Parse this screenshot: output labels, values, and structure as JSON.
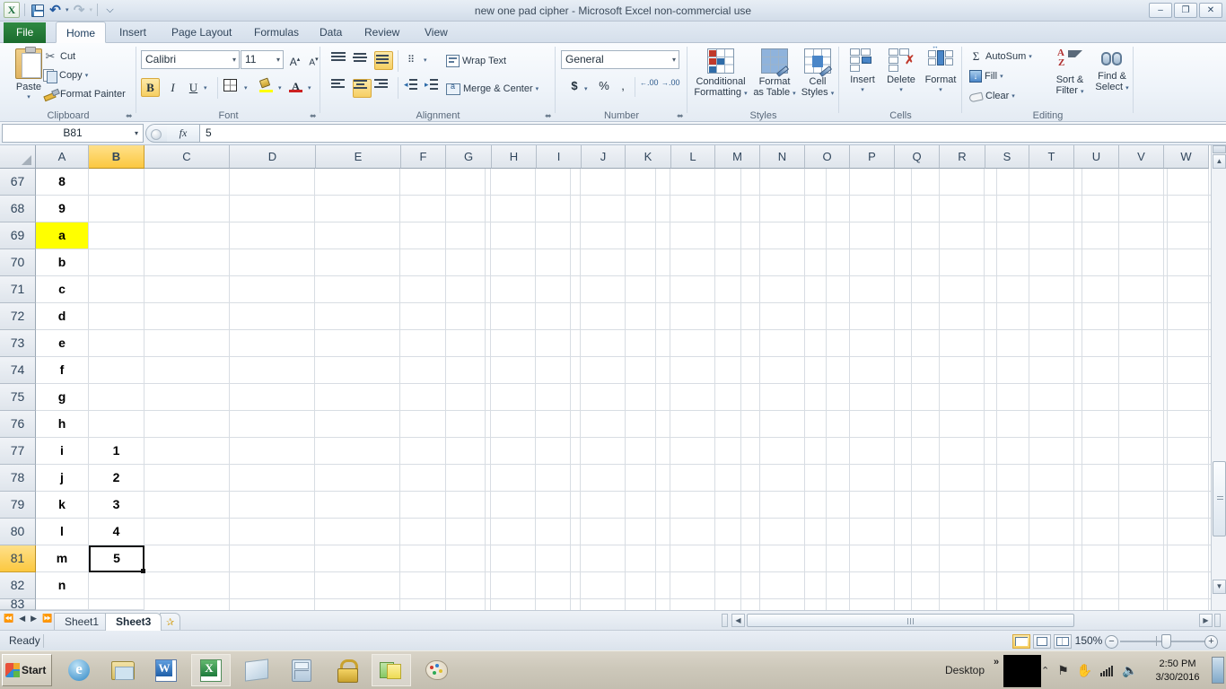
{
  "window": {
    "title": "new one pad cipher  -  Microsoft Excel non-commercial use",
    "minimize_label": "–",
    "restore_label": "❐",
    "close_label": "✕"
  },
  "quick_access": {
    "app_logo": "excel-logo",
    "save_label": "save-icon",
    "undo_label": "↶",
    "undo_caret": "▾",
    "redo_label": "↷",
    "redo_caret": "▾",
    "customize_label": "⌵"
  },
  "ribbon": {
    "tabs": [
      {
        "label": "File",
        "active": false,
        "is_file": true
      },
      {
        "label": "Home",
        "active": true
      },
      {
        "label": "Insert",
        "active": false
      },
      {
        "label": "Page Layout",
        "active": false
      },
      {
        "label": "Formulas",
        "active": false
      },
      {
        "label": "Data",
        "active": false
      },
      {
        "label": "Review",
        "active": false
      },
      {
        "label": "View",
        "active": false
      }
    ],
    "collapse_label": "⌃",
    "help_label": "?",
    "groups": {
      "clipboard": {
        "name": "Clipboard",
        "paste_label": "Paste",
        "paste_caret": "▾",
        "cut_label": "Cut",
        "copy_label": "Copy",
        "copy_caret": "▾",
        "format_painter_label": "Format Painter",
        "dialog_launcher": "⬌"
      },
      "font": {
        "name": "Font",
        "font_family_value": "Calibri",
        "font_size_value": "11",
        "grow_font_label": "A",
        "shrink_font_label": "A",
        "bold_label": "B",
        "italic_label": "I",
        "underline_label": "U",
        "underline_caret": "▾",
        "borders_caret": "▾",
        "fill_color_caret": "▾",
        "font_color_caret": "▾",
        "dialog_launcher": "⬌",
        "combo_caret": "▾"
      },
      "alignment": {
        "name": "Alignment",
        "orientation_caret": "▾",
        "wrap_text_label": "Wrap Text",
        "merge_center_label": "Merge & Center",
        "merge_caret": "▾",
        "dialog_launcher": "⬌"
      },
      "number": {
        "name": "Number",
        "format_value": "General",
        "format_caret": "▾",
        "currency_label": "$",
        "currency_caret": "▾",
        "percent_label": "%",
        "comma_label": ",",
        "increase_decimal_label": ".00",
        "decrease_decimal_label": ".00",
        "dialog_launcher": "⬌"
      },
      "styles": {
        "name": "Styles",
        "conditional_formatting_line1": "Conditional",
        "conditional_formatting_line2": "Formatting",
        "format_as_table_line1": "Format",
        "format_as_table_line2": "as Table",
        "cell_styles_line1": "Cell",
        "cell_styles_line2": "Styles",
        "caret": "▾"
      },
      "cells": {
        "name": "Cells",
        "insert_label": "Insert",
        "delete_label": "Delete",
        "format_label": "Format",
        "caret": "▾"
      },
      "editing": {
        "name": "Editing",
        "autosum_label": "AutoSum",
        "autosum_caret": "▾",
        "fill_label": "Fill",
        "fill_caret": "▾",
        "clear_label": "Clear",
        "clear_caret": "▾",
        "sort_filter_line1": "Sort &",
        "sort_filter_line2": "Filter",
        "find_select_line1": "Find &",
        "find_select_line2": "Select",
        "sigma_label": "Σ",
        "caret": "▾"
      }
    }
  },
  "formula_bar": {
    "name_box_value": "B81",
    "name_box_caret": "▾",
    "fx_label": "fx",
    "formula_value": "5",
    "cancel_label": "",
    "enter_label": ""
  },
  "grid": {
    "columns": [
      "A",
      "B",
      "C",
      "D",
      "E",
      "F",
      "G",
      "H",
      "I",
      "J",
      "K",
      "L",
      "M",
      "N",
      "O",
      "P",
      "Q",
      "R",
      "S",
      "T",
      "U",
      "V",
      "W"
    ],
    "selected_column": "B",
    "rows": [
      67,
      68,
      69,
      70,
      71,
      72,
      73,
      74,
      75,
      76,
      77,
      78,
      79,
      80,
      81,
      82,
      83
    ],
    "selected_row": 81,
    "cells": {
      "A": [
        "8",
        "9",
        "a",
        "b",
        "c",
        "d",
        "e",
        "f",
        "g",
        "h",
        "i",
        "j",
        "k",
        "l",
        "m",
        "n",
        ""
      ],
      "B": [
        "",
        "",
        "",
        "",
        "",
        "",
        "",
        "",
        "",
        "",
        "1",
        "2",
        "3",
        "4",
        "5",
        "",
        ""
      ]
    },
    "highlight": {
      "column": "A",
      "row": 69,
      "color": "#ffff00"
    },
    "active_cell": {
      "column": "B",
      "row": 81,
      "value": "5"
    }
  },
  "sheet_tabs": {
    "first_label": "⏮",
    "prev_label": "◀",
    "next_label": "▶",
    "last_label": "⏭",
    "tabs": [
      {
        "label": "Sheet1",
        "active": false
      },
      {
        "label": "Sheet3",
        "active": true
      }
    ],
    "new_sheet_label": "new-sheet-icon"
  },
  "status_bar": {
    "mode": "Ready",
    "zoom_level": "150%",
    "zoom_out_label": "−",
    "zoom_in_label": "+",
    "view_normal": "normal-view",
    "view_page_layout": "page-layout-view",
    "view_page_break": "page-break-view"
  },
  "taskbar": {
    "start_label": "Start",
    "items": [
      {
        "name": "internet-explorer",
        "active": false
      },
      {
        "name": "file-explorer",
        "active": false
      },
      {
        "name": "microsoft-word",
        "active": false
      },
      {
        "name": "microsoft-excel",
        "active": true
      },
      {
        "name": "notepad",
        "active": false
      },
      {
        "name": "calculator",
        "active": false
      },
      {
        "name": "lock-app",
        "active": false
      },
      {
        "name": "sticky-notes",
        "active": true
      },
      {
        "name": "paint",
        "active": false
      }
    ],
    "desktop_label": "Desktop",
    "overflow_label": "»",
    "tray_expand_label": "⌃",
    "tray_flag_label": "⚑",
    "tray_action_label": "✋",
    "time": "2:50 PM",
    "date": "3/30/2016"
  },
  "colors": {
    "highlight_yellow": "#ffff00",
    "header_selected": "#fbc840",
    "file_tab_green": "#1b6b2e",
    "grid_line": "#d8dde3"
  }
}
